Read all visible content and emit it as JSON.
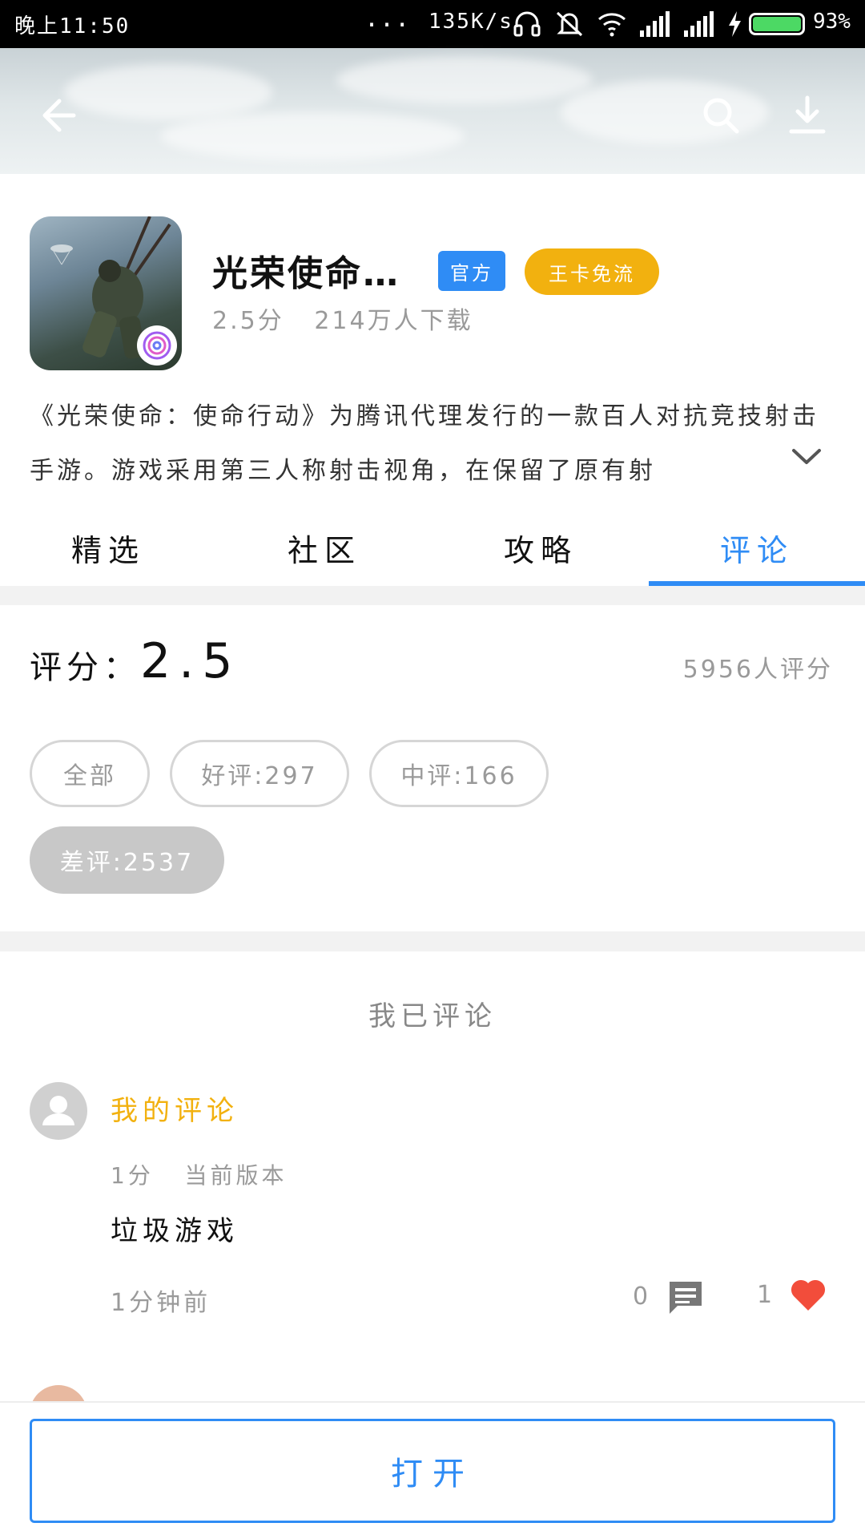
{
  "status_bar": {
    "time": "晚上11:50",
    "dots": "...",
    "net_speed": "135K/s",
    "battery_percent": "93%",
    "icons": [
      "headset-icon",
      "mute-icon",
      "wifi-icon",
      "signal-icon",
      "signal-icon",
      "charging-icon",
      "battery-icon"
    ]
  },
  "header": {
    "back_icon": "back-arrow-icon",
    "search_icon": "search-icon",
    "download_icon": "download-icon"
  },
  "app": {
    "title": "光荣使命…",
    "tag_official": "官方",
    "tag_free": "王卡免流",
    "rating_text": "2.5分",
    "downloads": "214万人下载",
    "description": "《光荣使命：使命行动》为腾讯代理发行的一款百人对抗竞技射击手游。游戏采用第三人称射击视角，在保留了原有射"
  },
  "tabs": [
    {
      "label": "精选",
      "active": false
    },
    {
      "label": "社区",
      "active": false
    },
    {
      "label": "攻略",
      "active": false
    },
    {
      "label": "评论",
      "active": true
    }
  ],
  "rating": {
    "label": "评分：",
    "value": "2.5",
    "raters": "5956人评分"
  },
  "filters": {
    "all": "全部",
    "good": "好评:297",
    "medium": "中评:166",
    "bad": "差评:2537",
    "selected": "bad"
  },
  "my_review": {
    "section_title": "我已评论",
    "author": "我的评论",
    "score": "1分",
    "version": "当前版本",
    "text": "垃圾游戏",
    "time": "1分钟前",
    "reply_count": "0",
    "like_count": "1"
  },
  "bottom": {
    "open_label": "打开"
  },
  "colors": {
    "accent": "#2f8cf5",
    "gold": "#f2b10f",
    "like": "#f24d3b"
  }
}
